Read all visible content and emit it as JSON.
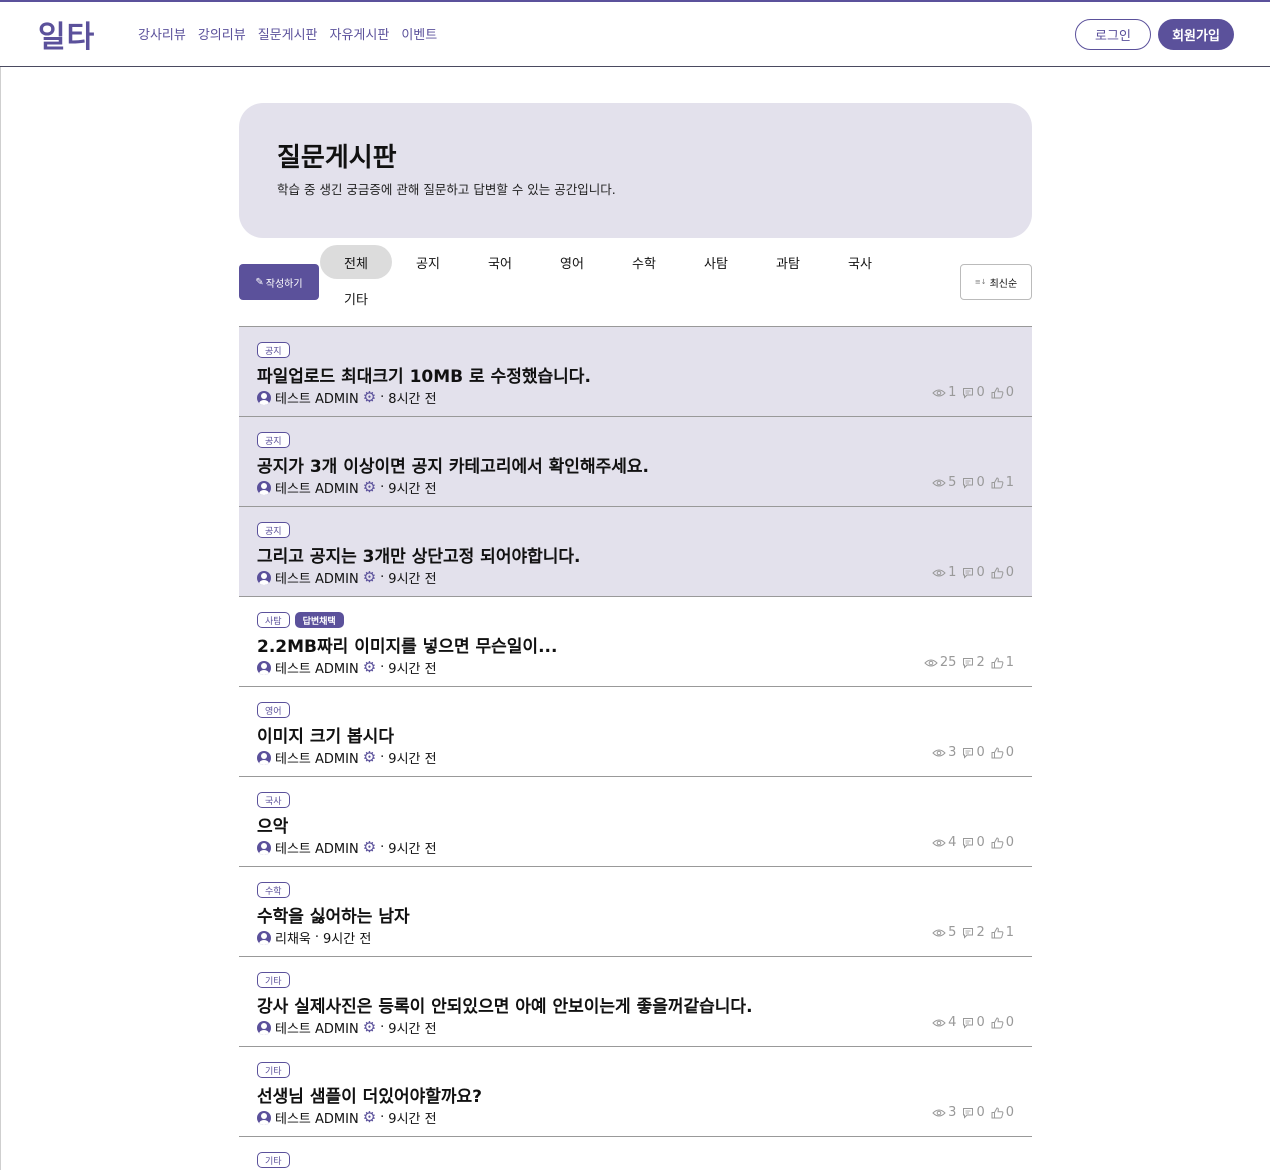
{
  "header": {
    "logo": "일타",
    "nav": [
      "강사리뷰",
      "강의리뷰",
      "질문게시판",
      "자유게시판",
      "이벤트"
    ],
    "login": "로그인",
    "signup": "회원가입"
  },
  "hero": {
    "title": "질문게시판",
    "description": "학습 중 생긴 궁금증에 관해 질문하고 답변할 수 있는 공간입니다."
  },
  "toolbar": {
    "write_icon": "pencil-icon",
    "write_label": "작성하기",
    "categories": [
      "전체",
      "공지",
      "국어",
      "영어",
      "수학",
      "사탐",
      "과탐",
      "국사",
      "기타"
    ],
    "active_category": "전체",
    "sort_label": "최신순",
    "sort_icon": "sort-icon"
  },
  "posts": [
    {
      "tags": [
        "공지"
      ],
      "title": "파일업로드 최대크기 10MB 로 수정했습니다.",
      "author": "테스트 ADMIN",
      "admin": true,
      "time": "8시간 전",
      "views": "1",
      "comments": "0",
      "likes": "0",
      "notice": true
    },
    {
      "tags": [
        "공지"
      ],
      "title": "공지가 3개 이상이면 공지 카테고리에서 확인해주세요.",
      "author": "테스트 ADMIN",
      "admin": true,
      "time": "9시간 전",
      "views": "5",
      "comments": "0",
      "likes": "1",
      "notice": true
    },
    {
      "tags": [
        "공지"
      ],
      "title": "그리고 공지는 3개만 상단고정 되어야합니다.",
      "author": "테스트 ADMIN",
      "admin": true,
      "time": "9시간 전",
      "views": "1",
      "comments": "0",
      "likes": "0",
      "notice": true
    },
    {
      "tags": [
        "사탐",
        "답변채택"
      ],
      "title": "2.2MB짜리 이미지를 넣으면 무슨일이...",
      "author": "테스트 ADMIN",
      "admin": true,
      "time": "9시간 전",
      "views": "25",
      "comments": "2",
      "likes": "1",
      "notice": false
    },
    {
      "tags": [
        "영어"
      ],
      "title": "이미지 크기 봅시다",
      "author": "테스트 ADMIN",
      "admin": true,
      "time": "9시간 전",
      "views": "3",
      "comments": "0",
      "likes": "0",
      "notice": false
    },
    {
      "tags": [
        "국사"
      ],
      "title": "으악",
      "author": "테스트 ADMIN",
      "admin": true,
      "time": "9시간 전",
      "views": "4",
      "comments": "0",
      "likes": "0",
      "notice": false
    },
    {
      "tags": [
        "수학"
      ],
      "title": "수학을 싫어하는 남자",
      "author": "리채욱",
      "admin": false,
      "time": "9시간 전",
      "views": "5",
      "comments": "2",
      "likes": "1",
      "notice": false
    },
    {
      "tags": [
        "기타"
      ],
      "title": "강사 실제사진은 등록이 안되있으면 아예 안보이는게 좋을꺼같습니다.",
      "author": "테스트 ADMIN",
      "admin": true,
      "time": "9시간 전",
      "views": "4",
      "comments": "0",
      "likes": "0",
      "notice": false
    },
    {
      "tags": [
        "기타"
      ],
      "title": "선생님 샘플이 더있어야할까요?",
      "author": "테스트 ADMIN",
      "admin": true,
      "time": "9시간 전",
      "views": "3",
      "comments": "0",
      "likes": "0",
      "notice": false
    },
    {
      "tags": [
        "기타"
      ],
      "title": "",
      "author": "",
      "admin": false,
      "time": "",
      "views": "",
      "comments": "",
      "likes": "",
      "notice": false
    }
  ],
  "colors": {
    "accent": "#5b519b",
    "notice_bg": "#e3e1ec",
    "stat_gray": "#999999"
  }
}
